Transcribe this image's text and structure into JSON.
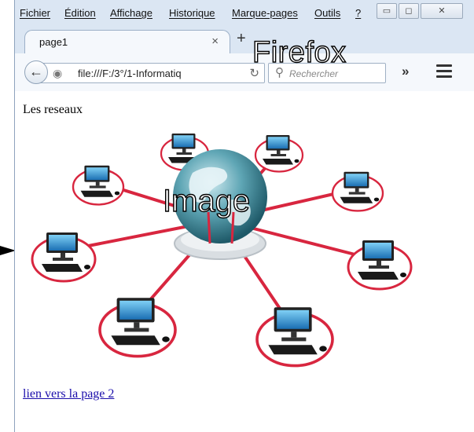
{
  "menubar": {
    "items": [
      "Fichier",
      "Édition",
      "Affichage",
      "Historique",
      "Marque-pages",
      "Outils",
      "?"
    ]
  },
  "tab": {
    "title": "page1",
    "close": "×"
  },
  "newtab": "+",
  "overlay": {
    "browser_name": "Firefox",
    "image_label": "Image"
  },
  "navbar": {
    "url": "file:///F:/3°/1-Informatiq",
    "search_placeholder": "Rechercher",
    "overflow": "»"
  },
  "page": {
    "heading": "Les reseaux",
    "link": "lien vers la page 2"
  },
  "colors": {
    "link": "#1a0dab",
    "accent": "#d8263f"
  }
}
